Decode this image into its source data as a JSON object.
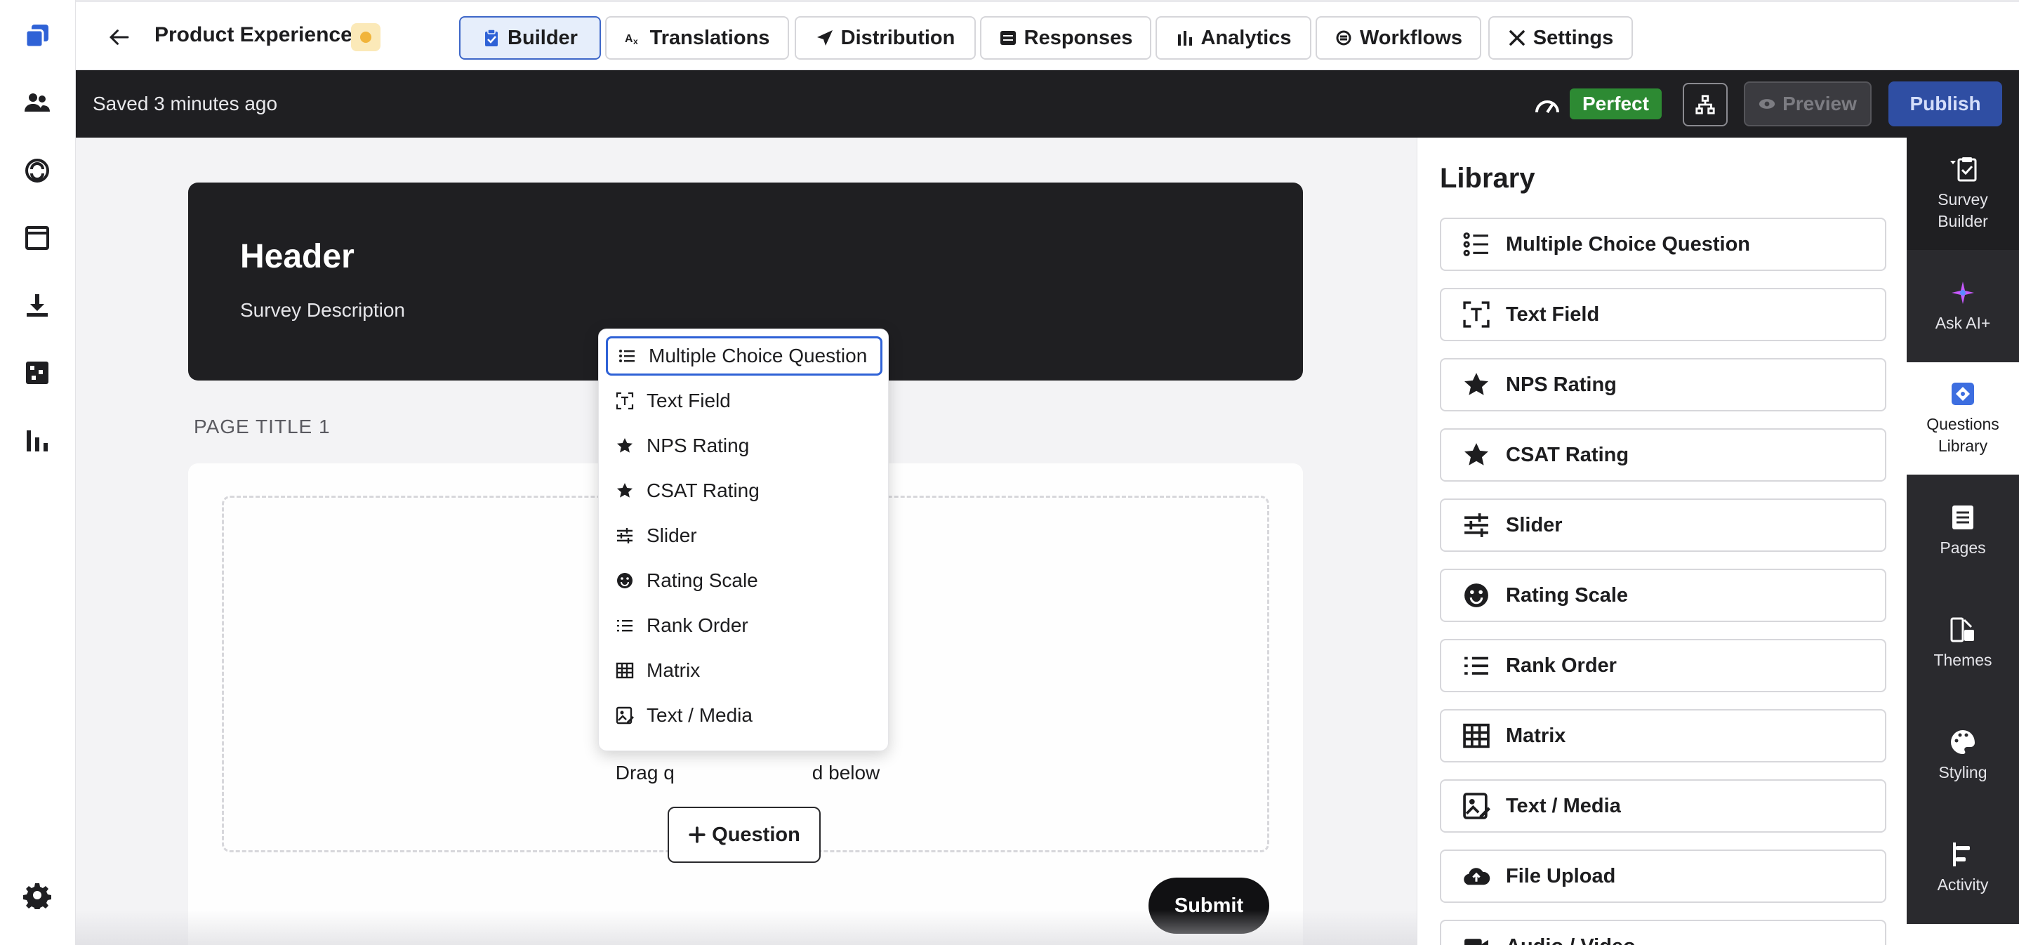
{
  "app": {
    "project_title": "Product Experience",
    "tabs": [
      {
        "label": "Builder",
        "icon": "clipboard-icon",
        "active": true
      },
      {
        "label": "Translations",
        "icon": "translate-icon",
        "active": false
      },
      {
        "label": "Distribution",
        "icon": "paper-plane-icon",
        "active": false
      },
      {
        "label": "Responses",
        "icon": "list-card-icon",
        "active": false
      },
      {
        "label": "Analytics",
        "icon": "bar-chart-icon",
        "active": false
      },
      {
        "label": "Workflows",
        "icon": "sync-icon",
        "active": false
      },
      {
        "label": "Settings",
        "icon": "tools-icon",
        "active": false
      }
    ],
    "left_nav": [
      "app-logo-icon",
      "people-icon",
      "support-icon",
      "window-icon",
      "download-icon",
      "qr-grid-icon",
      "bar-chart-icon",
      "gear-icon"
    ]
  },
  "toolbar": {
    "saved_text": "Saved 3 minutes ago",
    "score_label": "Perfect",
    "preview_label": "Preview",
    "publish_label": "Publish",
    "score_color": "#2d8a33",
    "publish_color": "#2f4ea3"
  },
  "canvas": {
    "header_title": "Header",
    "header_description": "Survey Description",
    "page_title": "PAGE TITLE 1",
    "drag_hint": "Drag q",
    "drag_hint_end": "d below",
    "add_question_label": "Question",
    "submit_label": "Submit"
  },
  "dropdown": {
    "items": [
      {
        "label": "Multiple Choice Question",
        "icon": "list-bullets-icon"
      },
      {
        "label": "Text Field",
        "icon": "text-field-icon"
      },
      {
        "label": "NPS Rating",
        "icon": "star-icon"
      },
      {
        "label": "CSAT Rating",
        "icon": "star-icon"
      },
      {
        "label": "Slider",
        "icon": "sliders-icon"
      },
      {
        "label": "Rating Scale",
        "icon": "smiley-icon"
      },
      {
        "label": "Rank Order",
        "icon": "numbered-list-icon"
      },
      {
        "label": "Matrix",
        "icon": "table-grid-icon"
      },
      {
        "label": "Text / Media",
        "icon": "media-edit-icon"
      }
    ]
  },
  "library": {
    "title": "Library",
    "items": [
      {
        "label": "Multiple Choice Question",
        "icon": "list-bullets-icon"
      },
      {
        "label": "Text Field",
        "icon": "text-field-icon"
      },
      {
        "label": "NPS Rating",
        "icon": "star-icon"
      },
      {
        "label": "CSAT Rating",
        "icon": "star-icon"
      },
      {
        "label": "Slider",
        "icon": "sliders-icon"
      },
      {
        "label": "Rating Scale",
        "icon": "smiley-icon"
      },
      {
        "label": "Rank Order",
        "icon": "numbered-list-icon"
      },
      {
        "label": "Matrix",
        "icon": "table-grid-icon"
      },
      {
        "label": "Text / Media",
        "icon": "media-edit-icon"
      },
      {
        "label": "File Upload",
        "icon": "cloud-upload-icon"
      },
      {
        "label": "Audio / Video",
        "icon": "video-icon"
      }
    ]
  },
  "rail": {
    "items": [
      {
        "label": "Survey Builder",
        "icon": "clipboard-check-icon"
      },
      {
        "label": "Ask AI+",
        "icon": "sparkle-icon"
      },
      {
        "label": "Questions Library",
        "icon": "questions-library-icon"
      },
      {
        "label": "Pages",
        "icon": "pages-icon"
      },
      {
        "label": "Themes",
        "icon": "themes-icon"
      },
      {
        "label": "Styling",
        "icon": "palette-icon"
      },
      {
        "label": "Activity",
        "icon": "activity-icon"
      }
    ]
  }
}
